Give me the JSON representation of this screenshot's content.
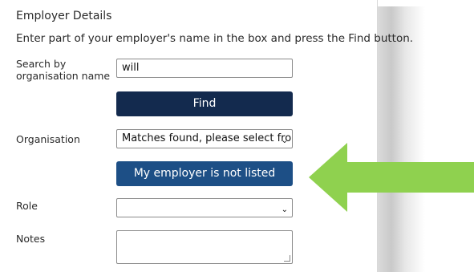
{
  "form": {
    "title": "Employer Details",
    "instruction": "Enter part of your employer's name in the box and press the Find button.",
    "search": {
      "label_line1": "Search by",
      "label_line2": "organisation name",
      "value": "will"
    },
    "find_button": "Find",
    "organisation": {
      "label": "Organisation",
      "selected": "Matches found, please select fror"
    },
    "not_listed_button": "My employer is not listed",
    "role": {
      "label": "Role",
      "selected": ""
    },
    "notes": {
      "label": "Notes",
      "value": ""
    }
  },
  "colors": {
    "find_button": "#132a4e",
    "not_listed_button": "#1d4f86",
    "arrow": "#8fd14f"
  },
  "icons": {
    "dropdown": "chevron-down-icon",
    "pointer": "green-arrow-icon"
  }
}
